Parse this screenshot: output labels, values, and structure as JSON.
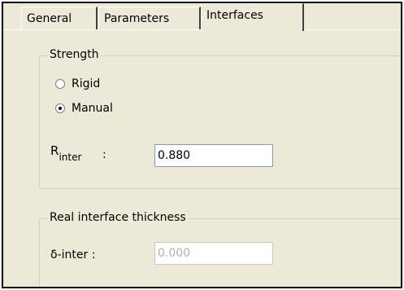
{
  "tabs": [
    {
      "label": "General",
      "active": false
    },
    {
      "label": "Parameters",
      "active": false
    },
    {
      "label": "Interfaces",
      "active": true
    }
  ],
  "strength": {
    "legend": "Strength",
    "options": [
      {
        "label": "Rigid",
        "checked": false
      },
      {
        "label": "Manual",
        "checked": true
      }
    ],
    "r_inter": {
      "label_main": "R",
      "label_sub": "inter",
      "label_colon": ":",
      "value": "0.880"
    }
  },
  "real_interface": {
    "legend": "Real interface thickness",
    "delta_label": "δ-inter :",
    "delta_value": "0.000",
    "delta_disabled": true
  }
}
